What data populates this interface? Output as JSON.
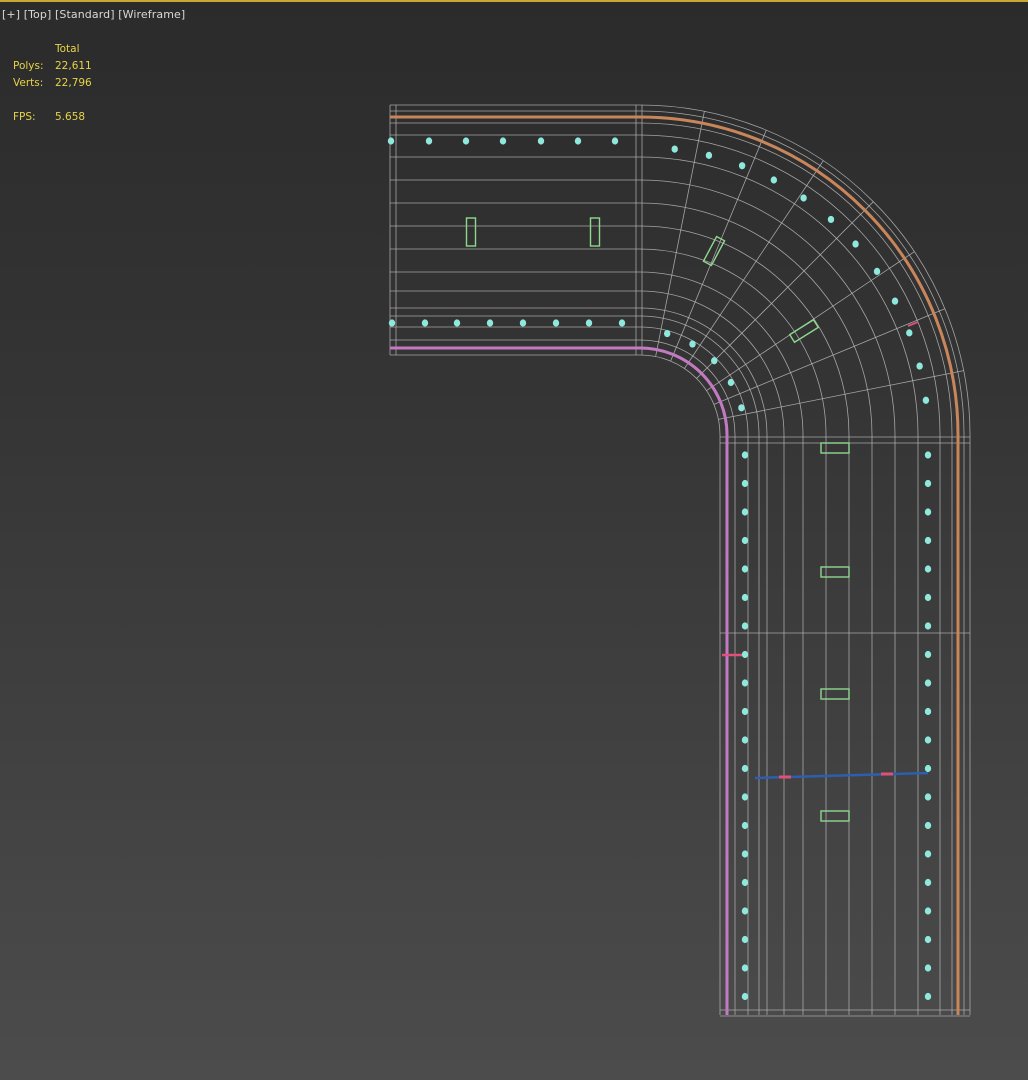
{
  "viewport": {
    "label_plus": "[+]",
    "label_view": "[Top]",
    "label_shading": "[Standard]",
    "label_mode": "[Wireframe]"
  },
  "stats": {
    "total_header": "Total",
    "polys_label": "Polys:",
    "polys_value": "22,611",
    "verts_label": "Verts:",
    "verts_value": "22,796",
    "fps_label": "FPS:",
    "fps_value": "5.658"
  },
  "colors": {
    "wire": "#b9b9b9",
    "outer_curb": "#c8865a",
    "inner_curb": "#c27ac2",
    "studs": "#8ee8dc",
    "markers": "#8ed88e",
    "selection_blue": "#2e5fae",
    "selection_pink": "#e0507a",
    "accent_top_border": "#c8a934"
  },
  "icons": {
    "stud": "cyan-dot",
    "marker": "green-rectangle"
  }
}
